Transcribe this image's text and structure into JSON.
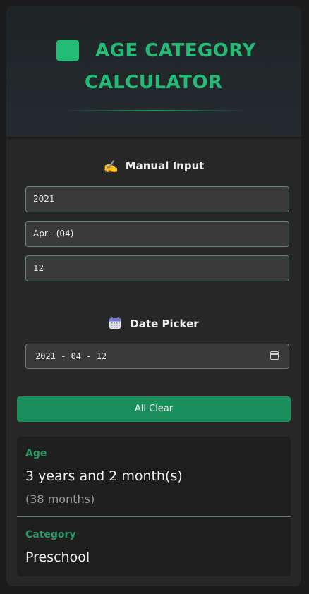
{
  "header": {
    "title_line1": "AGE CATEGORY",
    "title_line2": "CALCULATOR",
    "logo_color": "#24bb77"
  },
  "manual_input": {
    "title": "Manual Input",
    "icon": "writing-hand-icon",
    "icon_glyph": "✍️",
    "year_value": "2021",
    "month_value": "Apr - (04)",
    "day_value": "12"
  },
  "date_picker": {
    "title": "Date Picker",
    "icon": "calendar-icon",
    "value": "2021 - 04 - 12",
    "picker_icon": "calendar-picker-icon"
  },
  "actions": {
    "clear_label": "All Clear",
    "clear_color": "#1b8f5b"
  },
  "result": {
    "age_label": "Age",
    "age_value": "3 years and 2 month(s)",
    "age_months": "(38 months)",
    "category_label": "Category",
    "category_value": "Preschool"
  }
}
